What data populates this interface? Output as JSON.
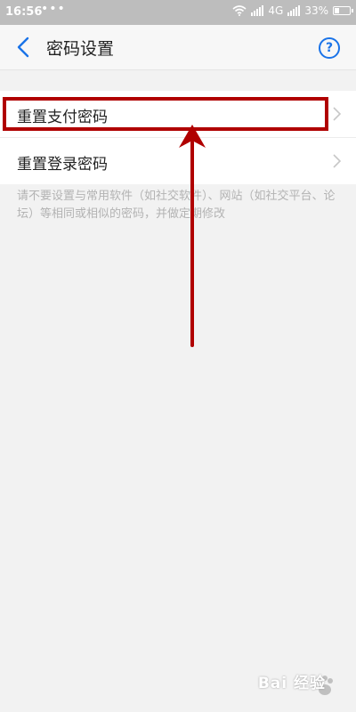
{
  "status_bar": {
    "time": "16:56",
    "dots": "•••",
    "network": "4G",
    "battery": "33%",
    "battery_level": 0.33
  },
  "nav": {
    "title": "密码设置",
    "help_symbol": "?"
  },
  "menu": {
    "items": [
      {
        "label": "重置支付密码"
      },
      {
        "label": "重置登录密码"
      }
    ]
  },
  "hint": {
    "text": "请不要设置与常用软件（如社交软件）、网站（如社交平台、论坛）等相同或相似的密码，并做定期修改"
  },
  "annotation": {
    "color": "#b00000"
  },
  "watermark": {
    "text": "Bai 经验"
  }
}
